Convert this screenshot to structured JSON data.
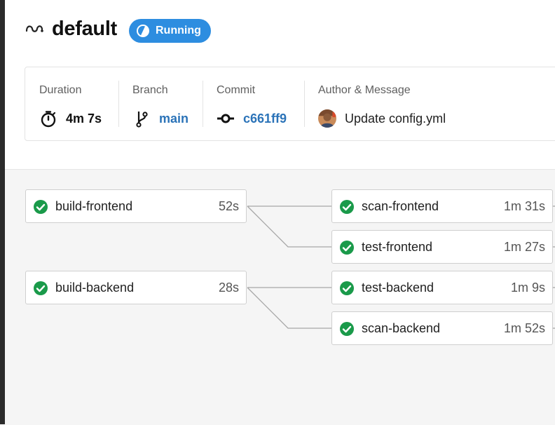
{
  "header": {
    "workflow_icon": "workflow-icon",
    "title": "default",
    "status": {
      "label": "Running",
      "icon": "running-icon",
      "color": "#2d8de0"
    }
  },
  "info": {
    "duration": {
      "label": "Duration",
      "value": "4m 7s",
      "icon": "stopwatch-icon"
    },
    "branch": {
      "label": "Branch",
      "value": "main",
      "icon": "branch-icon"
    },
    "commit": {
      "label": "Commit",
      "value": "c661ff9",
      "icon": "commit-icon"
    },
    "author": {
      "label": "Author & Message",
      "message": "Update config.yml",
      "icon": "avatar"
    }
  },
  "jobs": {
    "build_frontend": {
      "name": "build-frontend",
      "duration": "52s",
      "status": "success"
    },
    "scan_frontend": {
      "name": "scan-frontend",
      "duration": "1m 31s",
      "status": "success"
    },
    "test_frontend": {
      "name": "test-frontend",
      "duration": "1m 27s",
      "status": "success"
    },
    "build_backend": {
      "name": "build-backend",
      "duration": "28s",
      "status": "success"
    },
    "test_backend": {
      "name": "test-backend",
      "duration": "1m 9s",
      "status": "success"
    },
    "scan_backend": {
      "name": "scan-backend",
      "duration": "1m 52s",
      "status": "success"
    }
  },
  "colors": {
    "success": "#1a9a4a",
    "link": "#2b73b8",
    "graph_background": "#f5f5f5",
    "connector": "#a6a6a6"
  }
}
